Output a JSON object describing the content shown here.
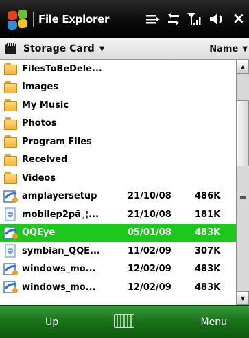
{
  "titlebar": {
    "title": "File Explorer",
    "icons": [
      "windows-flag-icon",
      "menu-lines-icon",
      "sync-arrows-icon",
      "signal-icon",
      "volume-icon",
      "close-icon"
    ],
    "close_glyph": "×"
  },
  "locationbar": {
    "folder": "Storage Card",
    "sort": "Name",
    "caret_glyph": "▼"
  },
  "files": [
    {
      "name": "FilesToBeDele...",
      "date": "",
      "size": "",
      "type": "folder"
    },
    {
      "name": "Images",
      "date": "",
      "size": "",
      "type": "folder"
    },
    {
      "name": "My Music",
      "date": "",
      "size": "",
      "type": "folder"
    },
    {
      "name": "Photos",
      "date": "",
      "size": "",
      "type": "folder"
    },
    {
      "name": "Program Files",
      "date": "",
      "size": "",
      "type": "folder"
    },
    {
      "name": "Received",
      "date": "",
      "size": "",
      "type": "folder"
    },
    {
      "name": "Videos",
      "date": "",
      "size": "",
      "type": "folder"
    },
    {
      "name": "amplayersetup",
      "date": "21/10/08",
      "size": "486K",
      "type": "installer"
    },
    {
      "name": "mobilep2pã¸¦...",
      "date": "21/10/08",
      "size": "181K",
      "type": "cab"
    },
    {
      "name": "QQEye",
      "date": "05/01/08",
      "size": "483K",
      "type": "installer"
    },
    {
      "name": "symbian_QQE...",
      "date": "11/02/09",
      "size": "307K",
      "type": "cab"
    },
    {
      "name": "windows_mo...",
      "date": "12/02/09",
      "size": "483K",
      "type": "installer"
    },
    {
      "name": "windows_mo...",
      "date": "12/02/09",
      "size": "483K",
      "type": "installer"
    }
  ],
  "selected_index": 9,
  "scrollbar": {
    "up_glyph": "▲",
    "down_glyph": "▼"
  },
  "softkeys": {
    "left": "Up",
    "center_icon": "keyboard-icon",
    "right": "Menu"
  },
  "colors": {
    "selection": "#1cc81c",
    "softbar": "#187018",
    "titlebar": "#000000"
  }
}
